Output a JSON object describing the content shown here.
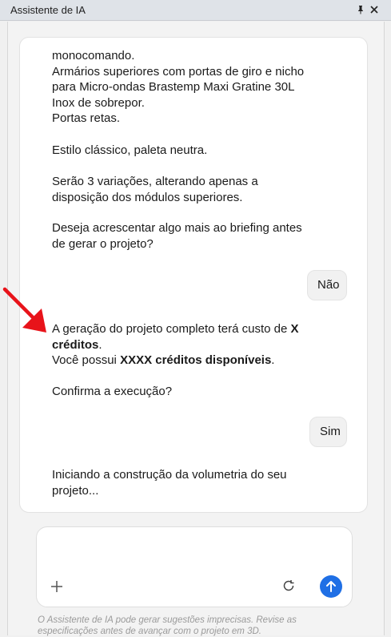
{
  "window": {
    "title": "Assistente de IA"
  },
  "messages": {
    "m1": "monocomando.\nArmários superiores com portas de giro e nicho para Micro-ondas Brastemp Maxi Gratine 30L Inox de sobrepor.\nPortas retas.",
    "m2": "Estilo clássico, paleta neutra.",
    "m3": "Serão 3 variações, alterando apenas a disposição dos módulos superiores.",
    "m4": "Deseja acrescentar algo mais ao briefing antes de gerar o projeto?",
    "user1": "Não",
    "m5_a": "A geração do projeto completo terá custo de ",
    "m5_b": "X créditos",
    "m5_c": ".",
    "m5_d": "Você possui ",
    "m5_e": "XXXX créditos disponíveis",
    "m5_f": ".",
    "m6": "Confirma a execução?",
    "user2": "Sim",
    "m7": "Iniciando a construção da volumetria do seu projeto..."
  },
  "composer": {
    "placeholder": ""
  },
  "disclaimer": "O Assistente de IA pode gerar sugestões imprecisas. Revise as especificações antes de avançar com o projeto em 3D.",
  "colors": {
    "send_button": "#1f6fe5",
    "annotation_arrow": "#e8131a"
  },
  "icons": {
    "pin": "pin-icon",
    "close": "close-icon",
    "add": "plus-icon",
    "refresh": "refresh-icon",
    "send": "arrow-up-icon"
  }
}
